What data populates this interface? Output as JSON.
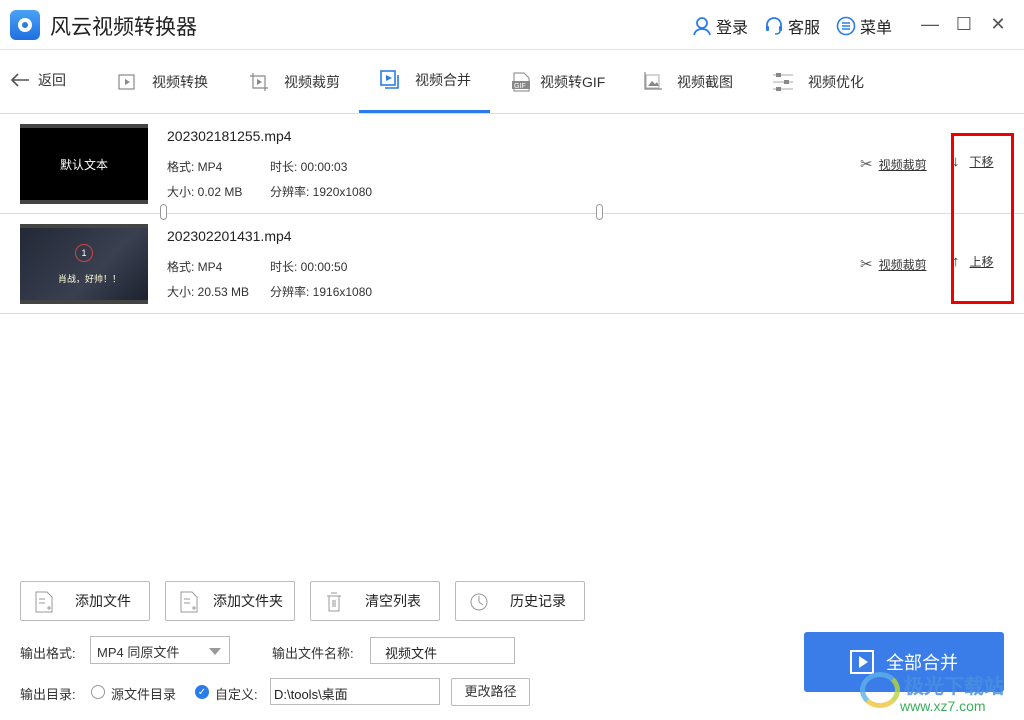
{
  "app": {
    "title": "风云视频转换器"
  },
  "titlebar": {
    "login": "登录",
    "service": "客服",
    "menu": "菜单",
    "minimize": "—",
    "maximize": "☐",
    "close": "✕"
  },
  "nav": {
    "back": "返回",
    "tabs": [
      {
        "label": "视频转换",
        "icon": "convert-icon"
      },
      {
        "label": "视频裁剪",
        "icon": "crop-icon"
      },
      {
        "label": "视频合并",
        "icon": "merge-icon",
        "active": true
      },
      {
        "label": "视频转GIF",
        "icon": "gif-icon"
      },
      {
        "label": "视频截图",
        "icon": "screenshot-icon"
      },
      {
        "label": "视频优化",
        "icon": "optimize-icon"
      }
    ]
  },
  "files": [
    {
      "thumb_text": "默认文本",
      "name": "202302181255.mp4",
      "format": "格式: MP4",
      "duration": "时长: 00:00:03",
      "size": "大小: 0.02 MB",
      "resolution": "分辨率: 1920x1080",
      "clip_label": "视频裁剪",
      "move_label": "下移",
      "move_arrow": "↓"
    },
    {
      "thumb_number": "1",
      "thumb_caption": "肖战，好帅！！",
      "name": "202302201431.mp4",
      "format": "格式: MP4",
      "duration": "时长: 00:00:50",
      "size": "大小: 20.53 MB",
      "resolution": "分辨率: 1916x1080",
      "clip_label": "视频裁剪",
      "move_label": "上移",
      "move_arrow": "↑"
    }
  ],
  "bottom": {
    "buttons": {
      "add_file": "添加文件",
      "add_folder": "添加文件夹",
      "clear_list": "清空列表",
      "history": "历史记录"
    },
    "output_format_label": "输出格式:",
    "output_format_value": "MP4 同原文件",
    "output_name_label": "输出文件名称:",
    "output_name_value": "视频文件",
    "output_dir_label": "输出目录:",
    "source_dir_option": "源文件目录",
    "custom_option": "自定义:",
    "custom_path": "D:\\tools\\桌面",
    "change_path": "更改路径",
    "merge_all": "全部合并"
  },
  "watermark": {
    "line1": "极光下载站",
    "line2": "www.xz7.com"
  },
  "colors": {
    "accent": "#3a7de9",
    "highlight": "#e00000"
  }
}
